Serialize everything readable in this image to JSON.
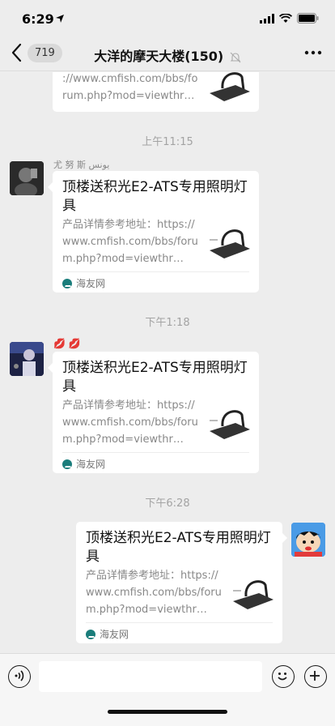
{
  "status": {
    "time": "6:29"
  },
  "nav": {
    "back_count": "719",
    "title": "大洋的摩天大楼(150)"
  },
  "messages": [
    {
      "kind": "card",
      "side": "left",
      "sender": "",
      "title": "",
      "desc": "://www.cmfish.com/bbs/forum.php?mod=viewthr…",
      "source": ""
    },
    {
      "kind": "time",
      "text": "上午11:15"
    },
    {
      "kind": "card",
      "side": "left",
      "sender": "尤 努 斯  يونس",
      "title": "顶楼送积光E2-ATS专用照明灯具",
      "desc": "产品详情参考地址：https://www.cmfish.com/bbs/forum.php?mod=viewthr…",
      "source": "海友网"
    },
    {
      "kind": "time",
      "text": "下午1:18"
    },
    {
      "kind": "card",
      "side": "left",
      "sender": "💋 💋",
      "title": "顶楼送积光E2-ATS专用照明灯具",
      "desc": "产品详情参考地址：https://www.cmfish.com/bbs/forum.php?mod=viewthr…",
      "source": "海友网"
    },
    {
      "kind": "time",
      "text": "下午6:28"
    },
    {
      "kind": "card",
      "side": "right",
      "sender": "",
      "title": "顶楼送积光E2-ATS专用照明灯具",
      "desc": "产品详情参考地址：https://www.cmfish.com/bbs/forum.php?mod=viewthr…",
      "source": "海友网"
    }
  ],
  "input": {
    "placeholder": ""
  },
  "icons": {
    "back": "chevron-left-icon",
    "mute": "bell-off-icon",
    "more": "more-dots-icon",
    "voice": "voice-icon",
    "emoji": "emoji-icon",
    "plus": "plus-icon"
  },
  "colors": {
    "background": "#ededed",
    "bubble": "#ffffff",
    "source_icon": "#1a7d7b"
  }
}
